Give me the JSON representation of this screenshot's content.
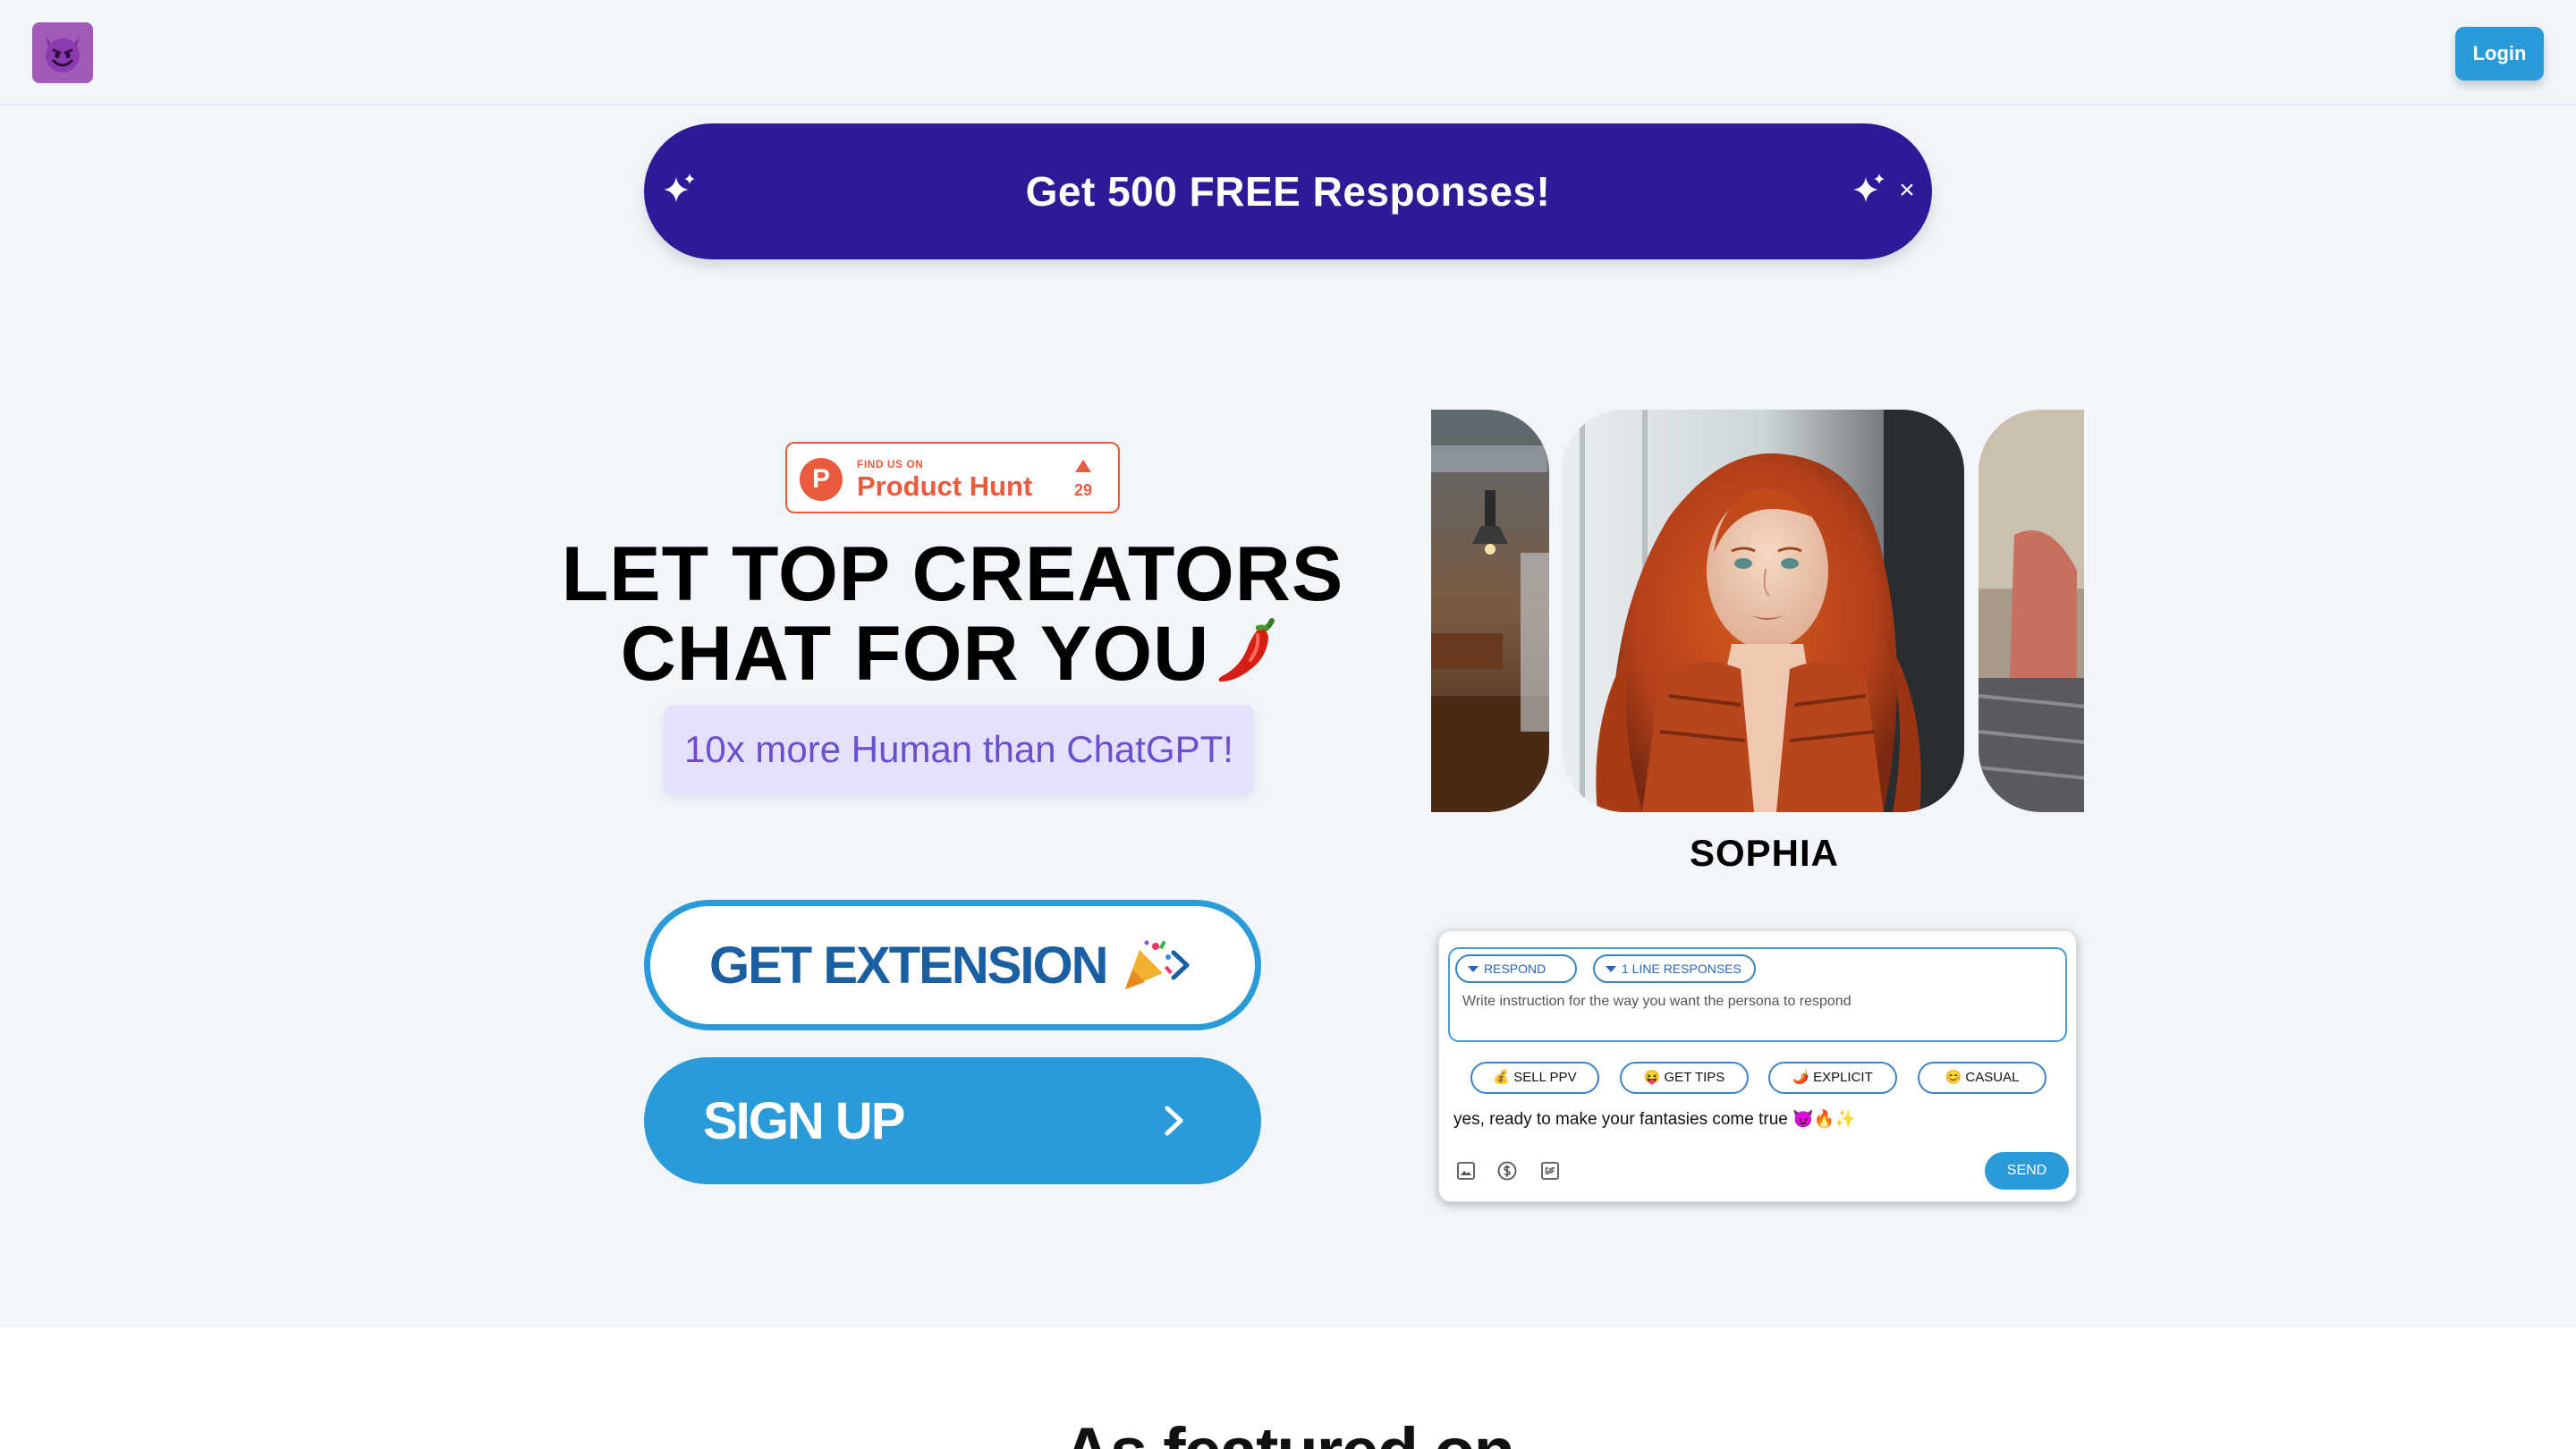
{
  "header": {
    "logo_icon": "smiling-devil-emoji",
    "login_label": "Login"
  },
  "promo": {
    "text": "Get 500 FREE Responses!",
    "close_glyph": "×"
  },
  "product_hunt": {
    "small_label": "FIND US ON",
    "name": "Product Hunt",
    "logo_letter": "P",
    "upvotes": "29"
  },
  "hero": {
    "title_line1": "LET TOP CREATORS",
    "title_line2": "CHAT FOR YOU",
    "subtitle": "10x more Human than ChatGPT!"
  },
  "cta": {
    "extension_label": "GET EXTENSION",
    "signup_label": "SIGN UP"
  },
  "persona": {
    "name": "SOPHIA"
  },
  "widget": {
    "respond_chip": "RESPOND",
    "lines_chip": "1 LINE RESPONSES",
    "instruction_placeholder": "Write instruction for the way you want the persona to respond",
    "tags": [
      "💰 SELL PPV",
      "😝 GET TIPS",
      "🌶️ EXPLICIT",
      "😊 CASUAL"
    ],
    "message": "yes, ready to make your fantasies come true 😈🔥✨",
    "send_label": "SEND"
  },
  "bottom": {
    "featured_title": "As featured on"
  },
  "colors": {
    "primary": "#2a9ad8",
    "promo_bg": "#2e1a96",
    "product_hunt": "#ea5a3d",
    "subtitle_bg": "#e6e1fa",
    "subtitle_text": "#6a4fd0"
  }
}
